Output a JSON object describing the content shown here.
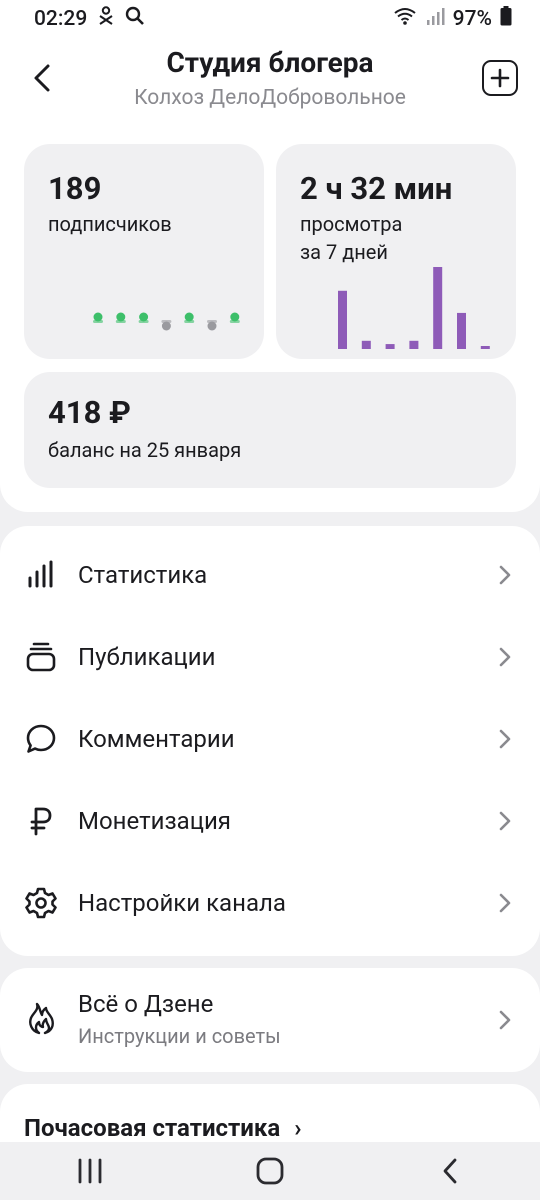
{
  "status_bar": {
    "time": "02:29",
    "battery": "97%"
  },
  "header": {
    "title": "Студия блогера",
    "subtitle": "Колхоз ДелоДобровольное"
  },
  "stats": {
    "subscribers": {
      "value": "189",
      "label": "подписчиков",
      "dots": [
        "up",
        "up",
        "up",
        "down",
        "up",
        "down",
        "up"
      ]
    },
    "views": {
      "value": "2 ч 32 мин",
      "label_line1": "просмотра",
      "label_line2": "за 7 дней",
      "bars": [
        0.71,
        0.1,
        0.06,
        0.1,
        1.0,
        0.44,
        0.03
      ]
    },
    "balance": {
      "value": "418 ₽",
      "label": "баланс на 25 января"
    }
  },
  "menu": {
    "items": [
      {
        "label": "Статистика",
        "icon": "bar-chart-icon"
      },
      {
        "label": "Публикации",
        "icon": "stack-icon"
      },
      {
        "label": "Комментарии",
        "icon": "comment-icon"
      },
      {
        "label": "Монетизация",
        "icon": "ruble-icon"
      },
      {
        "label": "Настройки канала",
        "icon": "gear-icon"
      }
    ]
  },
  "info": {
    "title": "Всё о Дзене",
    "subtitle": "Инструкции и советы",
    "icon": "flame-icon"
  },
  "peek": {
    "label": "Почасовая статистика"
  },
  "colors": {
    "accent_purple": "#8e5bb8",
    "dot_green": "#3dbf6a",
    "dot_gray": "#9a9a9f",
    "card_bg": "#f0f0f2"
  }
}
